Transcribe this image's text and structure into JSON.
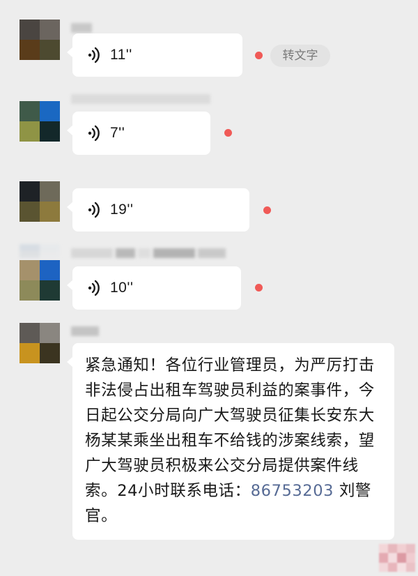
{
  "chat": {
    "voice_messages": [
      {
        "duration": "11''",
        "unread": true,
        "action_label": "转文字"
      },
      {
        "duration": "7''",
        "unread": true
      },
      {
        "duration": "19''",
        "unread": true
      },
      {
        "duration": "10''",
        "unread": true
      }
    ],
    "text_message": {
      "body_before_phone": "紧急通知！各位行业管理员，为严厉打击非法侵占出租车驾驶员利益的案事件，今日起公交分局向广大驾驶员征集长安东大杨某某乘坐出租车不给钱的涉案线索，望广大驾驶员积极来公交分局提供案件线索。24小时联系电话：",
      "phone": "86753203",
      "body_after_phone": " 刘警官。"
    }
  },
  "colors": {
    "background": "#ededed",
    "bubble": "#ffffff",
    "unread_dot": "#f05a57",
    "link": "#576b95"
  }
}
